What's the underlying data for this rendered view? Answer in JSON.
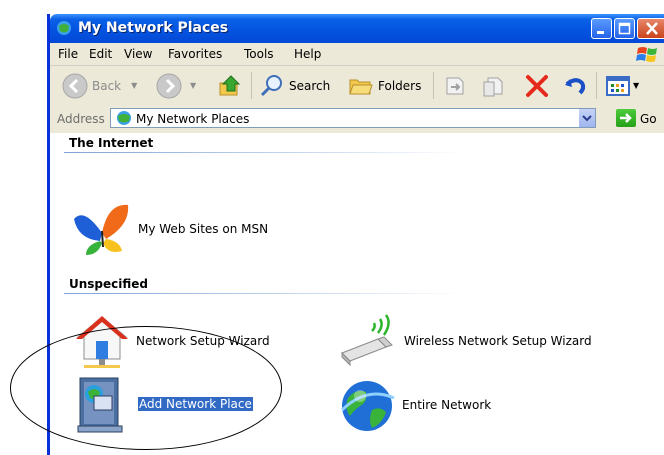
{
  "window": {
    "title": "My Network Places"
  },
  "menu": [
    "File",
    "Edit",
    "View",
    "Favorites",
    "Tools",
    "Help"
  ],
  "toolbar": {
    "back": "Back",
    "search": "Search",
    "folders": "Folders",
    "go": "Go"
  },
  "address": {
    "label": "Address",
    "value": "My Network Places"
  },
  "groups": {
    "internet": {
      "title": "The Internet",
      "items": [
        "My Web Sites on MSN"
      ]
    },
    "unspecified": {
      "title": "Unspecified",
      "items": [
        "Network Setup Wizard",
        "Wireless Network Setup Wizard",
        "Add Network Place",
        "Entire Network"
      ]
    }
  },
  "colors": {
    "title_bar": "#0454e0",
    "selection": "#316ac5",
    "chrome": "#ece9d8"
  }
}
